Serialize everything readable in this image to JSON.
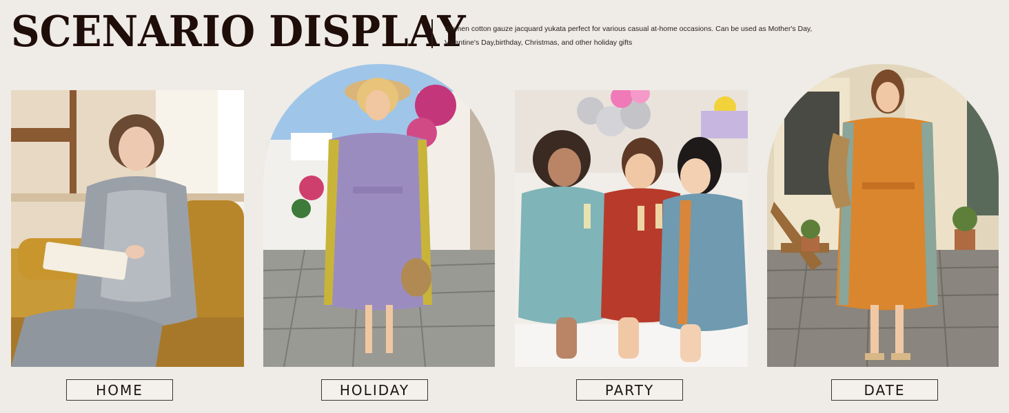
{
  "header": {
    "title": "SCENARIO DISPLAY",
    "description_line1": "Women cotton gauze jacquard yukata perfect for various casual at-home occasions. Can be used as Mother's Day,",
    "description_line2": "Valentine's Day,birthday, Christmas, and other holiday gifts"
  },
  "scenarios": [
    {
      "label": "HOME",
      "colors": {
        "robe": "#9aa0a8",
        "accent": "#c9962e"
      }
    },
    {
      "label": "HOLIDAY",
      "colors": {
        "robe": "#9b8cc0",
        "accent": "#c9b43a"
      }
    },
    {
      "label": "PARTY",
      "colors": {
        "robe": "#6f9ab0",
        "accent": "#b83a2a"
      }
    },
    {
      "label": "DATE",
      "colors": {
        "robe": "#d9862e",
        "accent": "#8aa59a"
      }
    }
  ]
}
